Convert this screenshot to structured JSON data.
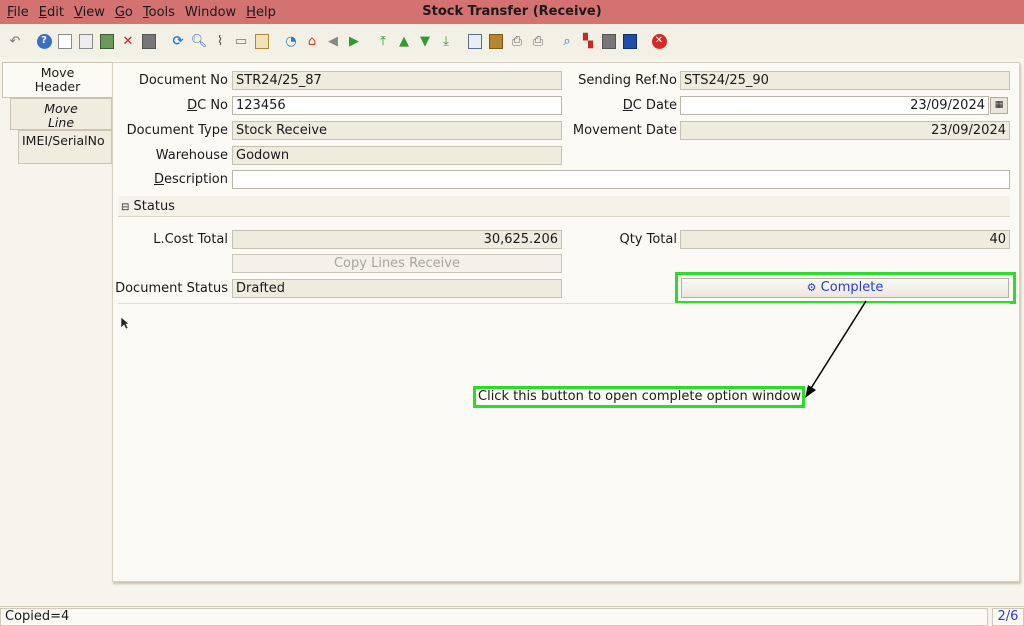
{
  "window": {
    "title": "Stock Transfer (Receive)"
  },
  "menu": [
    {
      "mnemonic": "F",
      "rest": "ile"
    },
    {
      "mnemonic": "E",
      "rest": "dit"
    },
    {
      "mnemonic": "V",
      "rest": "iew"
    },
    {
      "mnemonic": "G",
      "rest": "o"
    },
    {
      "mnemonic": "T",
      "rest": "ools"
    },
    {
      "mnemonic": "",
      "rest": "Window"
    },
    {
      "mnemonic": "H",
      "rest": "elp"
    }
  ],
  "toolbar_icons": [
    "undo-icon",
    "help-icon",
    "new-icon",
    "copy-icon",
    "save-icon",
    "delete-icon",
    "print-preview-icon",
    "refresh-icon",
    "find-icon",
    "attachment-icon",
    "chat-icon",
    "history-icon",
    "home-icon",
    "zoom-across-icon",
    "back-icon",
    "forward-icon",
    "first-record-icon",
    "previous-record-icon",
    "next-record-icon",
    "last-record-icon",
    "report-icon",
    "archive-icon",
    "print-icon",
    "print-2-icon",
    "zoom-icon",
    "workflow-icon",
    "request-icon",
    "product-info-icon",
    "exit-icon"
  ],
  "tabs": {
    "move_header": "Move Header",
    "move_line": "Move Line",
    "imei": "IMEI/SerialNo"
  },
  "form": {
    "document_no": {
      "label": "Document No",
      "value": "STR24/25_87"
    },
    "sending_ref": {
      "label": "Sending Ref.No",
      "value": "STS24/25_90"
    },
    "dc_no": {
      "label_mn": "D",
      "label_rest": "C No",
      "value": "123456"
    },
    "dc_date": {
      "label_mn": "D",
      "label_rest": "C Date",
      "value": "23/09/2024"
    },
    "document_type": {
      "label": "Document Type",
      "value": "Stock Receive"
    },
    "movement_date": {
      "label": "Movement Date",
      "value": "23/09/2024"
    },
    "warehouse": {
      "label": "Warehouse",
      "value": "Godown"
    },
    "description": {
      "label_mn": "D",
      "label_rest": "escription",
      "value": ""
    },
    "status_section": "Status",
    "lcost_total": {
      "label": "L.Cost Total",
      "value": "30,625.206"
    },
    "qty_total": {
      "label": "Qty Total",
      "value": "40"
    },
    "copy_lines_button": "Copy Lines Receive",
    "document_status": {
      "label": "Document Status",
      "value": "Drafted"
    },
    "complete_button": "Complete"
  },
  "annotation": "Click this button to open complete option window",
  "statusbar": {
    "message": "Copied=4",
    "record": "2/6"
  },
  "colors": {
    "titlebar": "#d47272",
    "highlight": "#2bdc2b",
    "link": "#2a3bd0"
  }
}
